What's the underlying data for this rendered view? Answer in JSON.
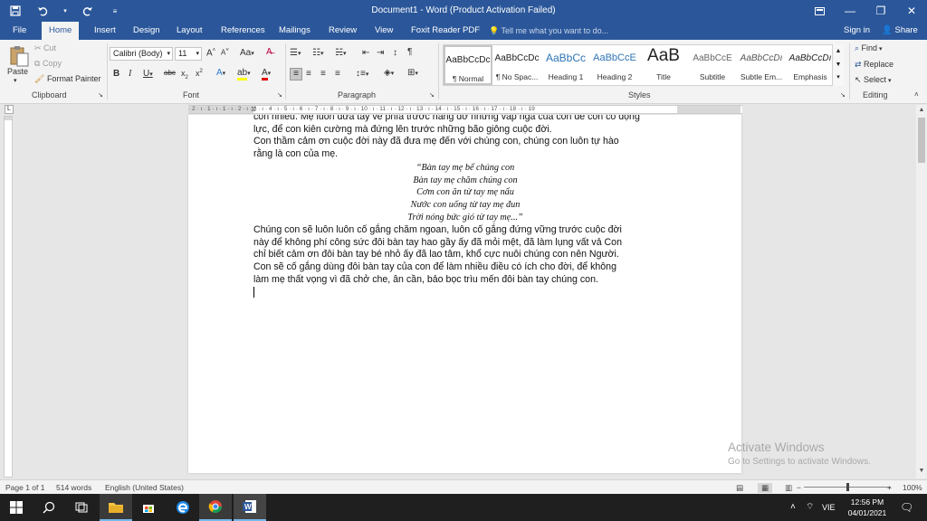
{
  "window": {
    "title": "Document1 - Word (Product Activation Failed)"
  },
  "qat": {
    "save_icon": "floppy-disk-icon",
    "undo_icon": "undo-icon",
    "redo_icon": "redo-icon",
    "customize_icon": "customize-qat-icon"
  },
  "tabs": [
    "File",
    "Home",
    "Insert",
    "Design",
    "Layout",
    "References",
    "Mailings",
    "Review",
    "View",
    "Foxit Reader PDF"
  ],
  "tell_me": "Tell me what you want to do...",
  "account": {
    "signin": "Sign in",
    "share": "Share"
  },
  "clipboard": {
    "paste": "Paste",
    "cut": "Cut",
    "copy": "Copy",
    "format_painter": "Format Painter",
    "label": "Clipboard"
  },
  "font": {
    "family": "Calibri (Body)",
    "size": "11",
    "label": "Font"
  },
  "paragraph": {
    "label": "Paragraph"
  },
  "styles": {
    "label": "Styles",
    "items": [
      {
        "sample": "AaBbCcDc",
        "name": "¶ Normal"
      },
      {
        "sample": "AaBbCcDc",
        "name": "¶ No Spac..."
      },
      {
        "sample": "AaBbCc",
        "name": "Heading 1"
      },
      {
        "sample": "AaBbCcE",
        "name": "Heading 2"
      },
      {
        "sample": "AaB",
        "name": "Title"
      },
      {
        "sample": "AaBbCcE",
        "name": "Subtitle"
      },
      {
        "sample": "AaBbCcDı",
        "name": "Subtle Em..."
      },
      {
        "sample": "AaBbCcDı",
        "name": "Emphasis"
      }
    ]
  },
  "editing": {
    "find": "Find",
    "replace": "Replace",
    "select": "Select",
    "label": "Editing"
  },
  "ruler_numbers": "· 2 · ı · 1 · ı · 1 · ı · 2 · ı · 3 · ı · 4 · ı · 5 · ı · 6 · ı · 7 · ı · 8 · ı · 9 · ı · 10 · ı · 11 · ı · 12 · ı · 13 · ı · 14 · ı · 15 · ı · 16 · ı · 17 · ı · 18 · ı · 19",
  "document": {
    "lines_top": [
      "con nhiều. Mẹ luôn đưa tay về phía trước nâng đỡ những vấp ngã của con để con có động",
      "lực, để con kiên cường mà đứng lên trước những bão giông cuộc đời.",
      "Con thầm cảm ơn cuộc đời này đã đưa mẹ đến với chúng con, chúng con luôn tự hào",
      "rằng là con của mẹ."
    ],
    "poem": [
      "“Bàn tay mẹ bế chúng con",
      "Bàn tay mẹ chăm chúng con",
      "Cơm con ăn từ tay mẹ nấu",
      "Nước con uống từ tay mẹ đun",
      "Trời nóng bức gió từ tay mẹ...”"
    ],
    "lines_bottom": [
      "Chúng con sẽ luôn luôn cố gắng chăm ngoan, luôn cố gắng đứng vững trước cuộc đời",
      "này để không phí công sức đôi bàn tay hao gầy ấy đã mỏi mệt, đã làm lụng vất vả Con",
      "chỉ biết cảm ơn đôi bàn tay bé nhỏ ấy đã lao tâm, khổ cực nuôi chúng con nên Người.",
      "Con sẽ cố gắng dùng đôi bàn tay của con để làm nhiều điều có ích cho đời, để không",
      "làm mẹ thất vọng vì đã chở che, ân cần, bảo bọc trìu mến đôi bàn tay chúng con."
    ]
  },
  "watermark": {
    "line1": "Activate Windows",
    "line2": "Go to Settings to activate Windows."
  },
  "status": {
    "page": "Page 1 of 1",
    "words": "514 words",
    "language": "English (United States)",
    "zoom": "100%",
    "zoom_fraction": 0.5
  },
  "taskbar": {
    "lang": "VIE",
    "time": "12:56 PM",
    "date": "04/01/2021"
  }
}
